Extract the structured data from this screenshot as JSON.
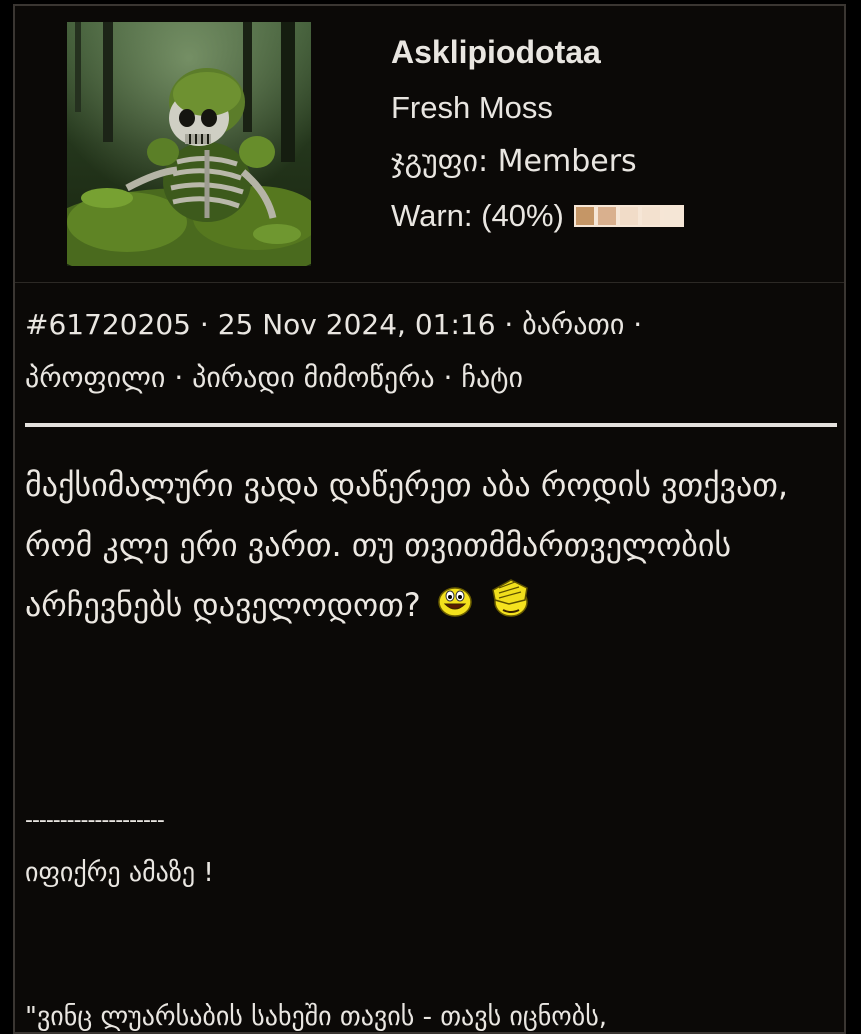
{
  "user": {
    "avatar_alt": "moss-covered skeleton avatar",
    "username": "Asklipiodotaa",
    "title": "Fresh Moss",
    "group": "ჯგუფი: Members",
    "warn_label": "Warn: (40%)",
    "warn_level": 0.4,
    "warn_colors": [
      "#c59666",
      "#d9b08e",
      "#f1dcc8",
      "#f3e1cf",
      "#f5e6d6"
    ]
  },
  "meta": {
    "post_id": "#61720205",
    "date": "25 Nov 2024, 01:16",
    "sep": " · ",
    "links": {
      "card": "ბარათი",
      "profile": "პროფილი",
      "pm": "პირადი მიმოწერა",
      "chat": "ჩატი"
    }
  },
  "post": {
    "body": "მაქსიმალური ვადა დაწერეთ აბა როდის ვთქვათ, რომ კლე ერი ვართ. თუ თვითმმართველობის არჩევნებს დაველოდოთ?",
    "smiley_1": "laughing-smiley",
    "smiley_2": "facepalm-smiley"
  },
  "signature": {
    "dashes": "--------------------",
    "line1": "იფიქრე ამაზე !",
    "quote": "\"ვინც ლუარსაბის სახეში თავის - თავს იცნობს,"
  },
  "colors": {
    "background": "#000000",
    "panel": "#0b0907",
    "text": "#ece8e2",
    "divider": "#e5e2de"
  }
}
